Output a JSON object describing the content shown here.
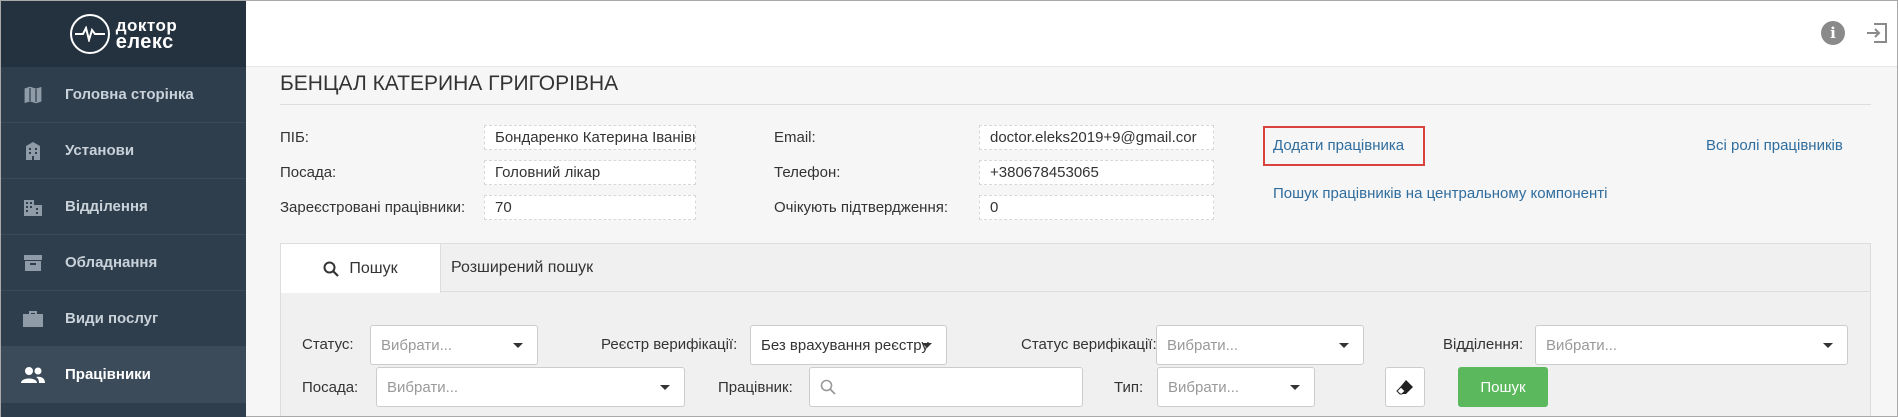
{
  "logo": {
    "line1": "доктор",
    "line2": "елекс"
  },
  "sidebar": {
    "items": [
      {
        "label": "Головна сторінка",
        "icon": "map-icon"
      },
      {
        "label": "Установи",
        "icon": "building-icon"
      },
      {
        "label": "Відділення",
        "icon": "city-icon"
      },
      {
        "label": "Обладнання",
        "icon": "archive-icon"
      },
      {
        "label": "Види послуг",
        "icon": "briefcase-icon"
      },
      {
        "label": "Працівники",
        "icon": "users-icon",
        "active": true
      }
    ]
  },
  "header": {
    "info_icon": "i"
  },
  "page": {
    "title": "БЕНЦАЛ КАТЕРИНА ГРИГОРІВНА",
    "fields": {
      "pib_label": "ПІБ:",
      "pib_value": "Бондаренко Катерина Іванівна",
      "position_label": "Посада:",
      "position_value": "Головний лікар",
      "registered_label": "Зареєстровані працівники:",
      "registered_value": "70",
      "email_label": "Email:",
      "email_value": "doctor.eleks2019+9@gmail.cor",
      "phone_label": "Телефон:",
      "phone_value": "+380678453065",
      "pending_label": "Очікують підтвердження:",
      "pending_value": "0"
    },
    "links": {
      "add_employee": "Додати працівника",
      "search_central": "Пошук працівників на центральному компоненті",
      "all_roles": "Всі ролі працівників"
    }
  },
  "search": {
    "tabs": {
      "search": "Пошук",
      "advanced": "Розширений пошук"
    },
    "status_label": "Статус:",
    "status_placeholder": "Вибрати...",
    "registry_label": "Реєстр верифікації:",
    "registry_value": "Без врахування реєстру",
    "verif_status_label": "Статус верифікації:",
    "verif_status_placeholder": "Вибрати...",
    "department_label": "Відділення:",
    "department_placeholder": "Вибрати...",
    "position_label": "Посада:",
    "position_placeholder": "Вибрати...",
    "employee_label": "Працівник:",
    "type_label": "Тип:",
    "type_placeholder": "Вибрати...",
    "search_button": "Пошук"
  },
  "colors": {
    "sidebar_bg": "#2e3e4c",
    "link": "#2f6d9e",
    "highlight": "#d9423f",
    "search_button": "#5cb85c"
  }
}
